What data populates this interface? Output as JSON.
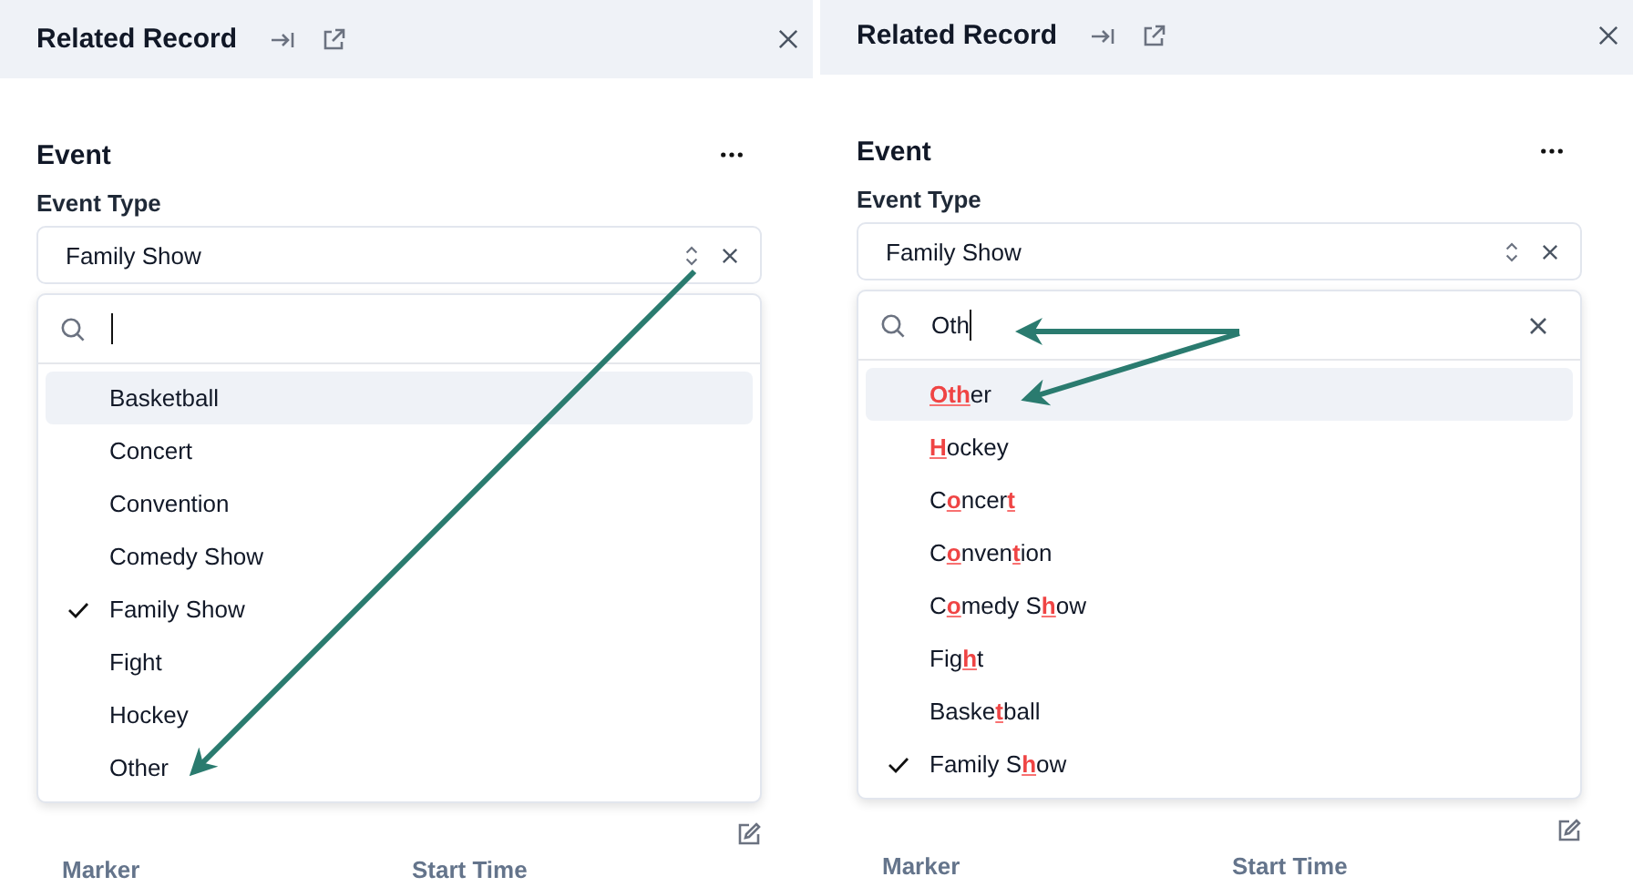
{
  "panels": [
    {
      "header": {
        "title": "Related Record"
      },
      "section": {
        "title": "Event",
        "field_label": "Event Type",
        "value": "Family Show"
      },
      "dropdown": {
        "options": [
          {
            "label": "Basketball",
            "selected": true,
            "checked": false
          },
          {
            "label": "Concert",
            "selected": false,
            "checked": false
          },
          {
            "label": "Convention",
            "selected": false,
            "checked": false
          },
          {
            "label": "Comedy Show",
            "selected": false,
            "checked": false
          },
          {
            "label": "Family Show",
            "selected": false,
            "checked": true
          },
          {
            "label": "Fight",
            "selected": false,
            "checked": false
          },
          {
            "label": "Hockey",
            "selected": false,
            "checked": false
          },
          {
            "label": "Other",
            "selected": false,
            "checked": false
          }
        ]
      },
      "table": {
        "columns": [
          "Marker",
          "Start Time"
        ]
      }
    },
    {
      "header": {
        "title": "Related Record"
      },
      "section": {
        "title": "Event",
        "field_label": "Event Type",
        "value": "Family Show"
      },
      "dropdown": {
        "search": {
          "value": "Oth"
        },
        "options": [
          {
            "label": "**Oth**er",
            "selected": true,
            "checked": false
          },
          {
            "label": "**H**ockey",
            "selected": false,
            "checked": false
          },
          {
            "label": "C**o**ncer**t**",
            "selected": false,
            "checked": false
          },
          {
            "label": "C**o**nven**t**ion",
            "selected": false,
            "checked": false
          },
          {
            "label": "C**o**medy S**h**ow",
            "selected": false,
            "checked": false
          },
          {
            "label": "Fig**h**t",
            "selected": false,
            "checked": false
          },
          {
            "label": "Baske**t**ball",
            "selected": false,
            "checked": false
          },
          {
            "label": "Family S**h**ow",
            "selected": false,
            "checked": true
          }
        ]
      },
      "table": {
        "columns": [
          "Marker",
          "Start Time"
        ]
      }
    }
  ]
}
